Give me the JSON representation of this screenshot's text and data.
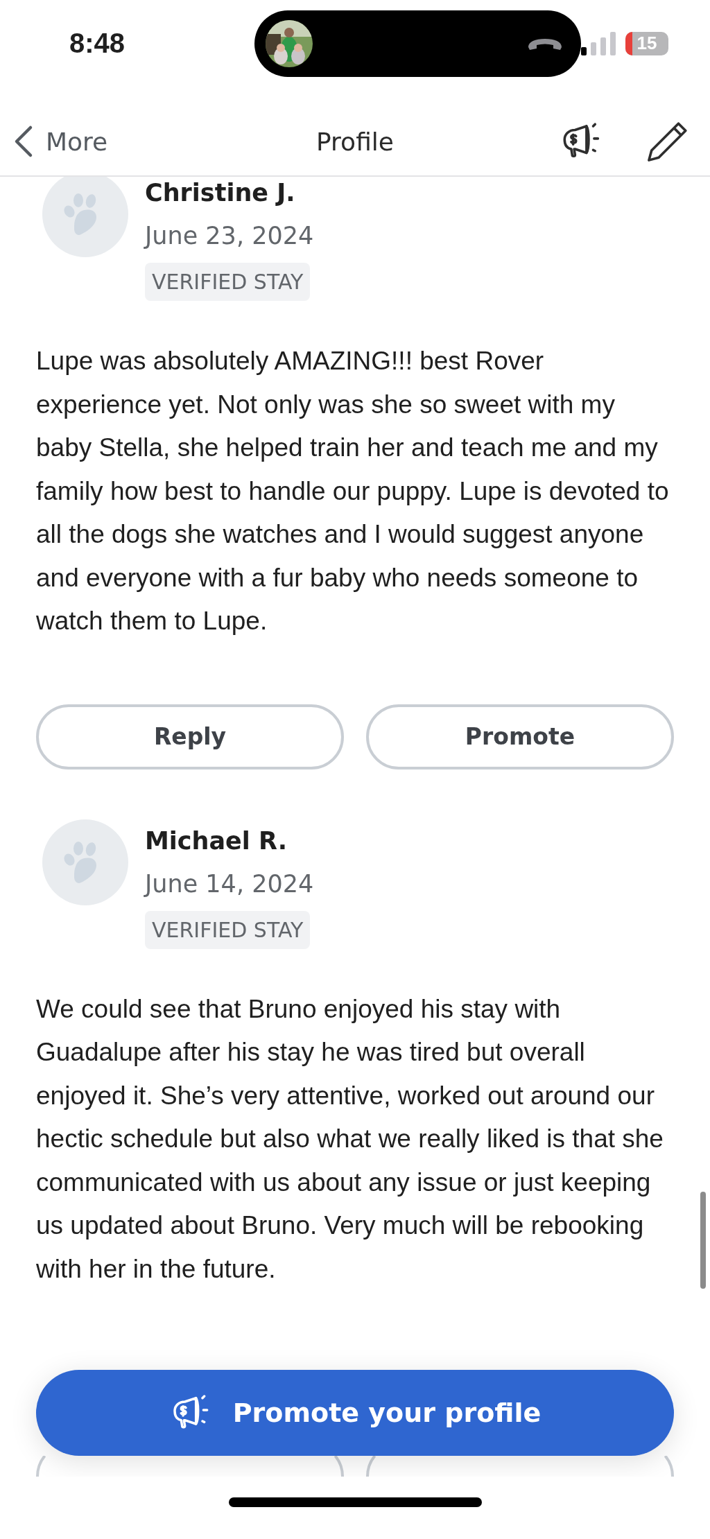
{
  "status_bar": {
    "time": "8:48",
    "battery": "15"
  },
  "header": {
    "back_label": "More",
    "title": "Profile"
  },
  "reviews": [
    {
      "name": "Christine J.",
      "date": "June 23, 2024",
      "badge": "VERIFIED STAY",
      "text": "Lupe was absolutely AMAZING!!! best Rover experience yet. Not only was she so sweet with my baby Stella, she helped train her and teach me and my family how best to handle our puppy. Lupe is devoted to all the dogs she watches and I would suggest anyone and everyone with a fur baby who needs someone to watch them to Lupe.",
      "buttons": [
        "Reply",
        "Promote"
      ]
    },
    {
      "name": "Michael R.",
      "date": "June 14, 2024",
      "badge": "VERIFIED STAY",
      "text": "We could see that Bruno enjoyed his stay with Guadalupe after his stay he was tired but overall enjoyed it. She’s very attentive, worked out around our hectic schedule but also what we really liked is that she communicated with us about any issue or just keeping us updated about Bruno. Very much will be rebooking with her in the future."
    }
  ],
  "promote_button": {
    "label": "Promote your profile"
  }
}
